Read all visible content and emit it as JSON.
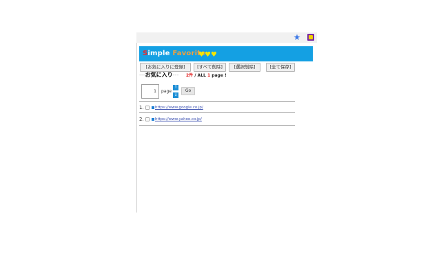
{
  "browser": {
    "star_icon": "★",
    "extension_icon": "simple-favorite-icon"
  },
  "header": {
    "title_parts": [
      {
        "text": "S",
        "color": "#e8292f"
      },
      {
        "text": "imple",
        "color": "#ffffff"
      },
      {
        "text": " ",
        "color": "#ffffff"
      },
      {
        "text": "Favorite",
        "color": "#f2a03c"
      }
    ],
    "hearts": "♥♥♥"
  },
  "toolbar": {
    "register_label": "[お気に入りに登録]",
    "delete_all_label": "[すべて削除]",
    "delete_selected_label": "[選択削除]",
    "save_all_label": "[全て保存]"
  },
  "favorites": {
    "dash_left": "---",
    "label": "お気に入り",
    "dash_right": "---",
    "count": "2件",
    "all_text": " / ALL ",
    "page_count": "1",
    "page_suffix": " page !"
  },
  "pager": {
    "page_value": "1",
    "page_label": "page",
    "up_arrow": "↑",
    "down_arrow": "↓",
    "go_label": "Go"
  },
  "items": [
    {
      "index": "1.",
      "url": "https://www.google.co.jp/"
    },
    {
      "index": "2.",
      "url": "https://www.yahoo.co.jp/"
    }
  ],
  "colors": {
    "header_bg": "#14a0e3",
    "count_red": "#e21b1b",
    "link": "#3a4fb0"
  }
}
